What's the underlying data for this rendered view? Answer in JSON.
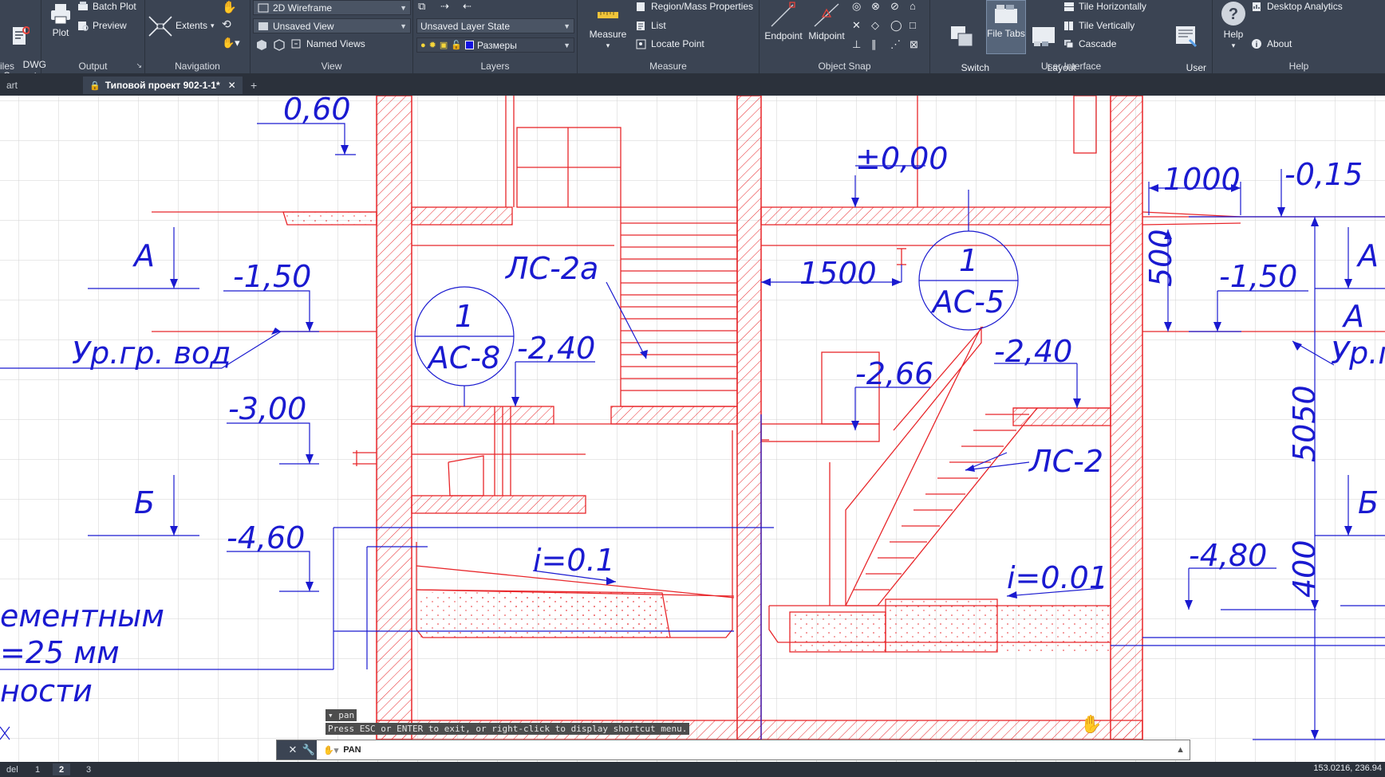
{
  "ribbon": {
    "files": {
      "dwg_convert": "DWG\nConvert",
      "title": "iles"
    },
    "output": {
      "plot": "Plot",
      "batch_plot": "Batch Plot",
      "preview": "Preview",
      "title": "Output"
    },
    "navigation": {
      "extents": "Extents",
      "title": "Navigation"
    },
    "view": {
      "visual_style": "2D Wireframe",
      "view_name": "Unsaved View",
      "named_views": "Named Views",
      "title": "View"
    },
    "layers": {
      "layer_state": "Unsaved Layer State",
      "current_layer": "Размеры",
      "title": "Layers"
    },
    "measure": {
      "measure": "Measure",
      "region_mass": "Region/Mass Properties",
      "list": "List",
      "locate_point": "Locate Point",
      "title": "Measure"
    },
    "object_snap": {
      "endpoint": "Endpoint",
      "midpoint": "Midpoint",
      "title": "Object Snap"
    },
    "user_interface": {
      "switch_windows": "Switch\nWindows",
      "file_tabs": "File Tabs",
      "layout_tabs": "Layout\nTabs",
      "tile_horizontally": "Tile Horizontally",
      "tile_vertically": "Tile Vertically",
      "cascade": "Cascade",
      "user_interface": "User\nInterface",
      "title": "User Interface"
    },
    "help": {
      "help": "Help",
      "desktop_analytics": "Desktop Analytics",
      "about": "About",
      "title": "Help"
    }
  },
  "tabs": {
    "start": "art",
    "current": "Типовой проект 902-1-1*",
    "close": "✕",
    "add": "+"
  },
  "drawing": {
    "elevations": [
      "0,60",
      "±0,00",
      "-0,15",
      "-1,50",
      "-1,50",
      "-2,40",
      "-2,40",
      "-2,66",
      "-3,00",
      "-4,60",
      "-4,80"
    ],
    "dimensions": [
      "1000",
      "1500",
      "500",
      "5050",
      "400"
    ],
    "section_marks": [
      "А",
      "А",
      "А",
      "Б",
      "Б"
    ],
    "labels": {
      "water_level": "Ур.гр. вод",
      "water_level_right": "Ур.г",
      "stair_a": "ЛС-2а",
      "stair": "ЛС-2",
      "slope1": "i=0.1",
      "slope2": "i=0.01",
      "note1": "ементным",
      "note2": "=25 мм",
      "note3": "ности"
    },
    "callouts": [
      {
        "num": "1",
        "ref": "АС-8"
      },
      {
        "num": "1",
        "ref": "АС-5"
      }
    ]
  },
  "command": {
    "tooltip": "pan",
    "hint": "Press ESC or ENTER to exit, or right-click to display shortcut menu.",
    "current": "PAN",
    "close_icon": "✕"
  },
  "status": {
    "model_tab": "del",
    "layout_tabs": [
      "1",
      "2",
      "3"
    ],
    "coords": "153.0216, 236.94"
  },
  "colors": {
    "ribbon": "#3b4453",
    "drawing_red": "#e8262a",
    "annotation_blue": "#1a1ad0",
    "grid": "#d2d2d2"
  }
}
